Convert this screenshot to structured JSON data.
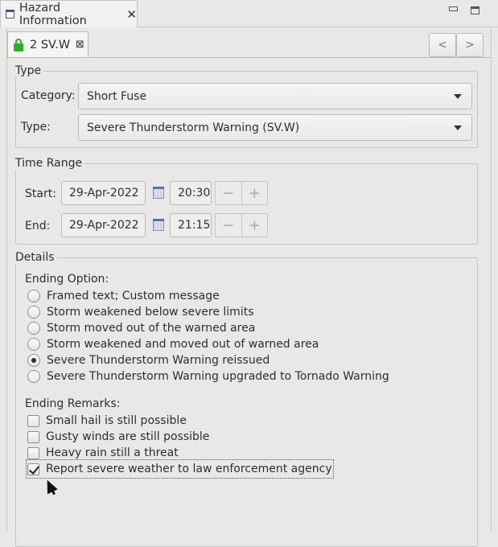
{
  "view": {
    "title": "Hazard Information",
    "close": "✕"
  },
  "hazard_tab": {
    "label": "2 SV.W",
    "close": "⊠",
    "prev": "<",
    "next": ">"
  },
  "type_group": {
    "title": "Type",
    "category_label": "Category:",
    "category_value": "Short Fuse",
    "type_label": "Type:",
    "type_value": "Severe Thunderstorm Warning (SV.W)"
  },
  "time_range": {
    "title": "Time Range",
    "start_label": "Start:",
    "start_date": "29-Apr-2022",
    "start_time": "20:30",
    "end_label": "End:",
    "end_date": "29-Apr-2022",
    "end_time": "21:15",
    "minus": "−",
    "plus": "+"
  },
  "details": {
    "title": "Details",
    "ending_option_label": "Ending Option:",
    "ending_options": [
      {
        "label": "Framed text; Custom message",
        "selected": false
      },
      {
        "label": "Storm weakened below severe limits",
        "selected": false
      },
      {
        "label": "Storm moved out of the warned area",
        "selected": false
      },
      {
        "label": "Storm weakened and moved out of warned area",
        "selected": false
      },
      {
        "label": "Severe Thunderstorm Warning reissued",
        "selected": true
      },
      {
        "label": "Severe Thunderstorm Warning upgraded to Tornado Warning",
        "selected": false
      }
    ],
    "ending_remarks_label": "Ending Remarks:",
    "ending_remarks": [
      {
        "label": "Small hail is still possible",
        "checked": false
      },
      {
        "label": "Gusty winds are still possible",
        "checked": false
      },
      {
        "label": "Heavy rain still a threat",
        "checked": false
      },
      {
        "label": "Report severe weather to law enforcement agency",
        "checked": true
      }
    ]
  },
  "icons": {
    "view_icon": "window-icon",
    "lock": "lock-icon",
    "calendar": "calendar-icon",
    "dropdown": "chevron-down-icon"
  },
  "colors": {
    "lock_green": "#23b323",
    "background": "#e8e8e7"
  }
}
